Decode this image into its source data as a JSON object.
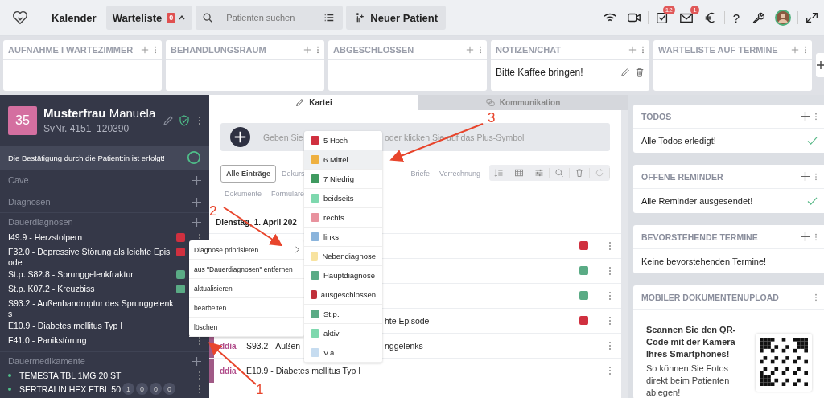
{
  "topbar": {
    "nav": [
      {
        "label": "Kalender",
        "selected": false
      },
      {
        "label": "Warteliste",
        "selected": true,
        "badge": "0"
      }
    ],
    "search": {
      "placeholder": "Patienten suchen"
    },
    "new_patient": "Neuer Patient",
    "tasks_badge": "12",
    "mail_badge": "1",
    "help": "?"
  },
  "columns": [
    {
      "title": "AUFNAHME I WARTEZIMMER"
    },
    {
      "title": "BEHANDLUNGSRAUM"
    },
    {
      "title": "ABGESCHLOSSEN"
    },
    {
      "title": "NOTIZEN/CHAT",
      "notes": [
        "Bitte Kaffee bringen!"
      ]
    },
    {
      "title": "WARTELISTE AUF TERMINE"
    }
  ],
  "patient": {
    "number": "35",
    "last_name": "Musterfrau",
    "first_name": "Manuela",
    "svnr": "SvNr. 4151  120390",
    "confirmation": "Die Bestätigung durch die Patient:in ist erfolgt!"
  },
  "sidebar": [
    {
      "kind": "simple",
      "title": "Cave"
    },
    {
      "kind": "simple",
      "title": "Diagnosen"
    },
    {
      "kind": "diagnoses",
      "title": "Dauerdiagnosen",
      "items": [
        {
          "text": "I49.9 - Herzstolpern",
          "color": "#d0303f"
        },
        {
          "text": "F32.0 - Depressive Störung als leichte Episode",
          "color": "#d0303f"
        },
        {
          "text": "St.p. S82.8 - Sprunggelenkfraktur",
          "color": "#5aab85"
        },
        {
          "text": "St.p. K07.2 - Kreuzbiss",
          "color": "#5aab85"
        },
        {
          "text": "S93.2 - Außenbandruptur des Sprunggelenks"
        },
        {
          "text": "E10.9 - Diabetes mellitus Typ I"
        },
        {
          "text": "F41.0 - Panikstörung"
        }
      ]
    },
    {
      "kind": "medications",
      "title": "Dauermedikamente",
      "items": [
        {
          "text": "TEMESTA TBL 1MG 20 ST"
        },
        {
          "text": "SERTRALIN HEX FTBL 50",
          "doses": [
            "1",
            "0",
            "0",
            "0"
          ]
        }
      ]
    }
  ],
  "context_menu": [
    {
      "label": "Diagnose priorisieren",
      "submenu": true
    },
    {
      "label": "aus \"Dauerdiagnosen\" entfernen",
      "submenu": false
    },
    {
      "label": "aktualisieren",
      "submenu": false
    },
    {
      "label": "bearbeiten",
      "submenu": false
    },
    {
      "label": "löschen",
      "submenu": false
    }
  ],
  "priority_menu": [
    {
      "label": "5 Hoch",
      "color": "#d0303f",
      "selected": false
    },
    {
      "label": "6 Mittel",
      "color": "#eeb040",
      "selected": true
    },
    {
      "label": "7 Niedrig",
      "color": "#3f9a60",
      "selected": false
    },
    {
      "label": "beidseits",
      "color": "#7ed8ae",
      "selected": false
    },
    {
      "label": "rechts",
      "color": "#e8929e",
      "selected": false
    },
    {
      "label": "links",
      "color": "#8ab4dc",
      "selected": false
    },
    {
      "label": "Nebendiagnose",
      "color": "#f8e3a0",
      "selected": false
    },
    {
      "label": "Hauptdiagnose",
      "color": "#5aab85",
      "selected": false
    },
    {
      "label": "ausgeschlossen",
      "color": "#c0303a",
      "selected": false
    },
    {
      "label": "St.p.",
      "color": "#5aab85",
      "selected": false
    },
    {
      "label": "aktiv",
      "color": "#7ed8ae",
      "selected": false
    },
    {
      "label": "V.a.",
      "color": "#c6dcf0",
      "selected": false
    }
  ],
  "record": {
    "tabs": [
      {
        "label": "Kartei",
        "selected": true
      },
      {
        "label": "Kommunikation",
        "selected": false
      }
    ],
    "entry_placeholder": [
      "Geben Sie",
      "oder klicken Sie auf das Plus-Symbol"
    ],
    "filters": [
      [
        {
          "label": "Alle Einträge",
          "selected": true
        },
        {
          "label": "Dekurs",
          "selected": false
        },
        {
          "label": "Briefe",
          "selected": false
        },
        {
          "label": "Verrechnung",
          "selected": false
        }
      ],
      [
        {
          "label": "Dokumente",
          "selected": false
        },
        {
          "label": "Formulare",
          "selected": false
        }
      ]
    ],
    "date": "Dienstag, 1. April 202",
    "entries": [
      {
        "color": "#d0303f"
      },
      {
        "color": "#5aab85"
      },
      {
        "color": "#5aab85"
      },
      {
        "right": "hte Episode",
        "color": "#d0303f"
      },
      {
        "tag": "ddia",
        "left": "S93.2 - Außen",
        "right": "nggelenks"
      },
      {
        "tag": "ddia",
        "left": "E10.9 - Diabetes mellitus Typ I"
      }
    ]
  },
  "cards": [
    {
      "kind": "status",
      "title": "TODOS",
      "body": "Alle Todos erledigt!",
      "done": true
    },
    {
      "kind": "status",
      "title": "OFFENE REMINDER",
      "body": "Alle Reminder ausgesendet!",
      "done": true
    },
    {
      "kind": "status",
      "title": "BEVORSTEHENDE TERMINE",
      "body": "Keine bevorstehenden Termine!",
      "done": false
    },
    {
      "kind": "upload",
      "title": "MOBILER DOKUMENTENUPLOAD",
      "headline": "Scannen Sie den QR-Code mit der Kamera Ihres Smartphones!",
      "body": "So können Sie Fotos direkt beim Patienten ablegen!"
    }
  ],
  "annotations": [
    "1",
    "2",
    "3"
  ]
}
